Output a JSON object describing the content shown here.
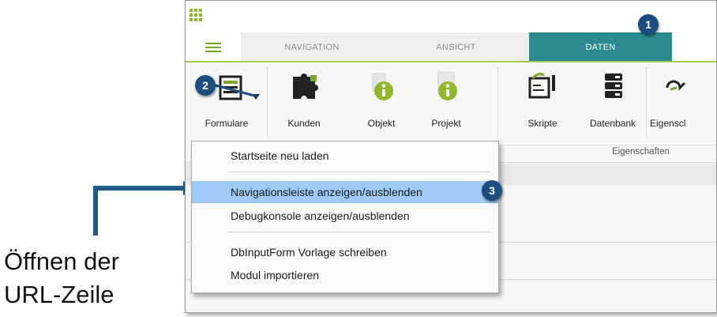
{
  "tabs": [
    {
      "label": "NAVIGATION",
      "active": false
    },
    {
      "label": "ANSICHT",
      "active": false
    },
    {
      "label": "DATEN",
      "active": true
    }
  ],
  "ribbon": {
    "buttons": [
      {
        "label": "Formulare",
        "icon": "form-list-icon"
      },
      {
        "label": "Kunden",
        "icon": "puzzle-icon"
      },
      {
        "label": "Objekt",
        "icon": "info-building-icon"
      },
      {
        "label": "Projekt",
        "icon": "info-building-icon"
      },
      {
        "label": "Skripte",
        "icon": "script-icon"
      },
      {
        "label": "Datenbank",
        "icon": "database-icon"
      },
      {
        "label": "Eigenscl",
        "icon": "properties-icon"
      }
    ],
    "group_label": "Eigenschaften"
  },
  "dropdown": {
    "items": [
      {
        "label": "Startseite neu laden"
      },
      {
        "label": "Navigationsleiste anzeigen/ausblenden",
        "highlighted": true
      },
      {
        "label": "Debugkonsole anzeigen/ausblenden"
      },
      {
        "label": "DbInputForm Vorlage schreiben"
      },
      {
        "label": "Modul importieren"
      }
    ]
  },
  "badges": [
    "1",
    "2",
    "3"
  ],
  "callout": {
    "line1": "Öffnen der",
    "line2": "URL-Zeile"
  },
  "colors": {
    "accent_teal": "#2c8b8e",
    "accent_green": "#8fb82a",
    "badge": "#1b4e7e",
    "arrow": "#1f5b8a",
    "highlight": "#9ecbf5"
  }
}
